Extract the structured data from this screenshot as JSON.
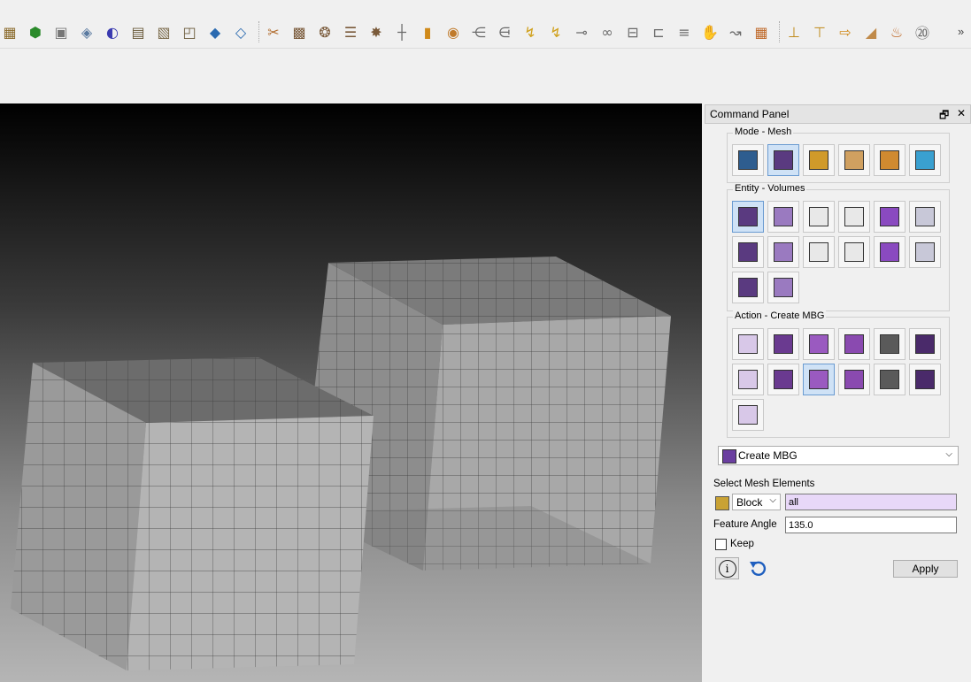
{
  "toolbar": {
    "overflow_label": "»",
    "icons": [
      "geometry-volume-icon",
      "green-volume-icon",
      "gray-volume-icon",
      "surface-icon",
      "blue-sphere-icon",
      "split-volume-icon",
      "box-select-icon",
      "corner-select-icon",
      "blue-cube-icon",
      "blue-cube-2-icon",
      "sweep-icon",
      "mesh-scheme-icon",
      "spiral-icon",
      "align-icon",
      "web-icon",
      "mesh-bars-icon",
      "brick-icon",
      "speaker-icon",
      "layer-icon",
      "layer-2-icon",
      "arrow-sweep-icon",
      "arrow-sweep-2-icon",
      "merge-icon",
      "coil-icon",
      "bracket-icon",
      "layers-3-icon",
      "sort-icon",
      "hand-icon",
      "curve-icon",
      "bricks-icon",
      "fix-bottom-icon",
      "fix-top-icon",
      "arrow-right-icon",
      "wedge-icon",
      "thermometer-icon",
      "number-22-icon"
    ]
  },
  "panel": {
    "title": "Command Panel",
    "float_label": "🗗",
    "close_label": "✕",
    "mode_group": {
      "label": "Mode - Mesh",
      "buttons": [
        "geometry-mode-icon",
        "mesh-mode-icon",
        "mesh-hex-mode-icon",
        "boundary-mode-icon",
        "material-mode-icon",
        "analysis-mode-icon"
      ],
      "selected": 1
    },
    "entity_group": {
      "label": "Entity - Volumes",
      "buttons": [
        "volumes-icon",
        "surfaces-icon",
        "curves-icon",
        "vertices-icon",
        "groups-icon",
        "grid-icon",
        "hex-icon",
        "tet-icon",
        "quad-icon",
        "tri-icon",
        "edge-icon",
        "node-icon",
        "sizing-icon",
        "block-icon"
      ],
      "selected": 0
    },
    "action_group": {
      "label": "Action - Create MBG",
      "buttons": [
        "boundary-icon",
        "block-assign-icon",
        "ribbon-icon",
        "smooth-icon",
        "copy-icon",
        "delete-icon",
        "quad-block-icon",
        "renumber-icon",
        "create-mbg-icon",
        "paint-icon",
        "cylinder-icon",
        "surface-mesh-icon",
        "column-icon"
      ],
      "selected": 8
    },
    "command_combo": "Create MBG",
    "select_label": "Select Mesh Elements",
    "type_combo": "Block",
    "select_value": "all",
    "feature_angle_label": "Feature Angle",
    "feature_angle_value": "135.0",
    "keep_label": "Keep",
    "apply_label": "Apply",
    "highlight_color": "#e8d8f8"
  }
}
